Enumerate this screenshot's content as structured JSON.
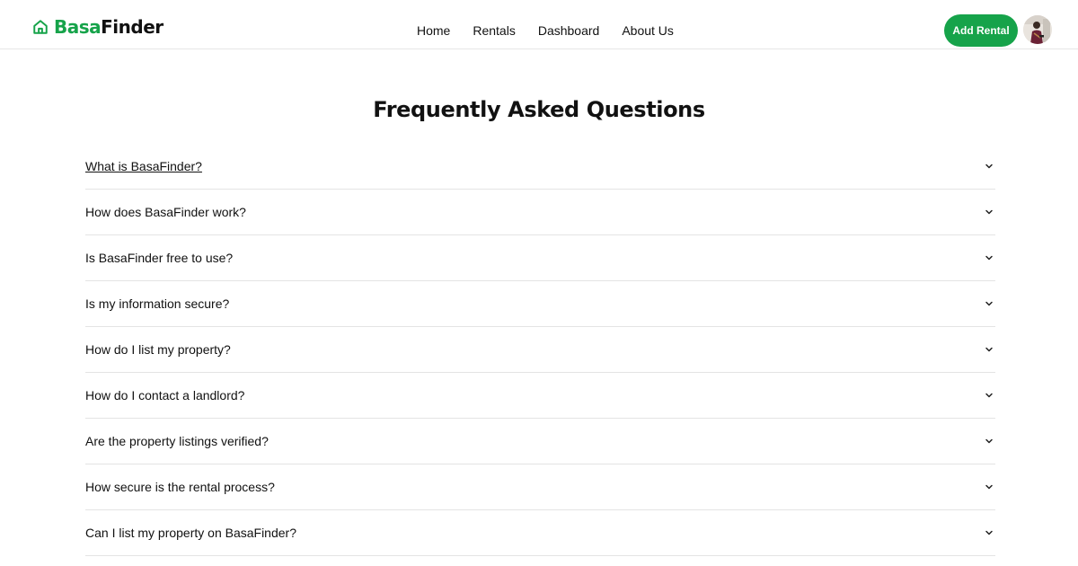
{
  "brand": {
    "part_a": "Basa",
    "part_b": "Finder",
    "icon": "house-icon",
    "accent_color": "#16a34a"
  },
  "nav": {
    "items": [
      "Home",
      "Rentals",
      "Dashboard",
      "About Us"
    ]
  },
  "header": {
    "add_button_label": "Add Rental",
    "add_button_color": "#16a34a",
    "avatar": "user-avatar"
  },
  "main": {
    "title": "Frequently Asked Questions",
    "faqs": [
      "What is BasaFinder?",
      "How does BasaFinder work?",
      "Is BasaFinder free to use?",
      "Is my information secure?",
      "How do I list my property?",
      "How do I contact a landlord?",
      "Are the property listings verified?",
      "How secure is the rental process?",
      "Can I list my property on BasaFinder?"
    ],
    "expand_icon": "chevron-down-icon"
  }
}
